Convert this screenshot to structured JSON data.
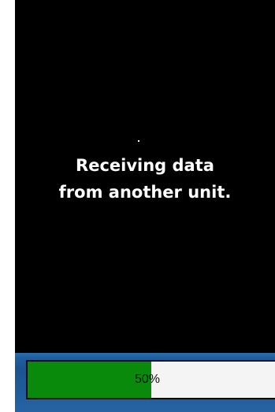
{
  "screen": {
    "message_line1": "Receiving data",
    "message_line2": "from another unit.",
    "progress_value": 50,
    "progress_label": "50%"
  },
  "colors": {
    "display_bg": "#000000",
    "message_text": "#ffffff",
    "bar_bg": "#1f5f9f",
    "progress_fill": "#0a8a0a",
    "progress_track": "#f4f4f4"
  }
}
